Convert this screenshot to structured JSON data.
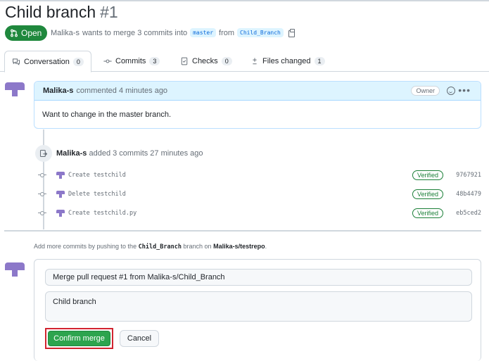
{
  "pr": {
    "title": "Child branch",
    "number": "#1",
    "state": "Open",
    "meta_author": "Malika-s",
    "meta_text": "wants to merge 3 commits into",
    "base_branch": "master",
    "from_text": "from",
    "head_branch": "Child_Branch"
  },
  "tabs": [
    {
      "label": "Conversation",
      "count": "0",
      "icon": "comment-discussion-icon"
    },
    {
      "label": "Commits",
      "count": "3",
      "icon": "git-commit-icon"
    },
    {
      "label": "Checks",
      "count": "0",
      "icon": "checklist-icon"
    },
    {
      "label": "Files changed",
      "count": "1",
      "icon": "file-diff-icon"
    }
  ],
  "comment": {
    "author": "Malika-s",
    "action": "commented 4 minutes ago",
    "role": "Owner",
    "body": "Want to change in the master branch."
  },
  "event": {
    "author": "Malika-s",
    "text": "added 3 commits 27 minutes ago"
  },
  "commits": [
    {
      "message": "Create testchild",
      "status": "Verified",
      "sha": "9767921"
    },
    {
      "message": "Delete testchild",
      "status": "Verified",
      "sha": "48b4479"
    },
    {
      "message": "Create testchild.py",
      "status": "Verified",
      "sha": "eb5ced2"
    }
  ],
  "push_hint": {
    "prefix": "Add more commits by pushing to the",
    "branch": "Child_Branch",
    "middle": "branch on",
    "repo": "Malika-s/testrepo",
    "suffix": "."
  },
  "merge": {
    "title_value": "Merge pull request #1 from Malika-s/Child_Branch",
    "body_value": "Child branch",
    "confirm_label": "Confirm merge",
    "cancel_label": "Cancel"
  },
  "colors": {
    "open_green": "#1f883d",
    "confirm_green": "#2da44e",
    "highlight_red": "#d1242f",
    "link_blue": "#0969da",
    "avatar_purple": "#8c78c9"
  }
}
